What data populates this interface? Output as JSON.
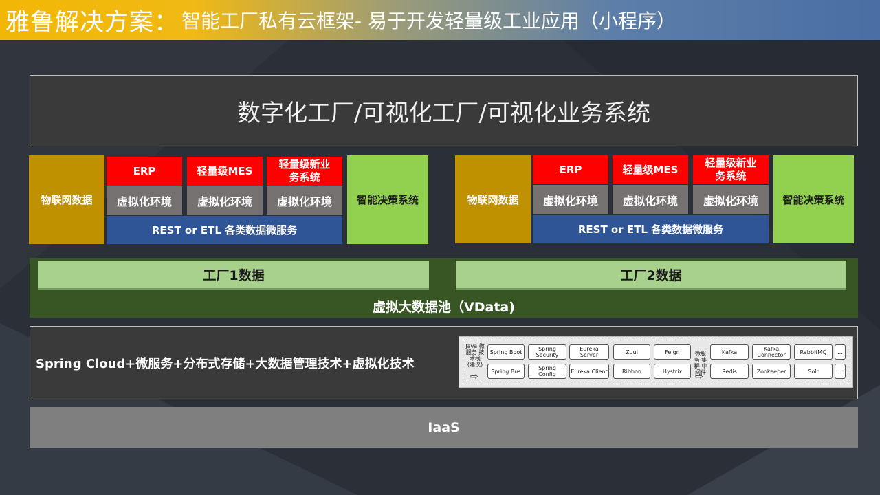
{
  "header": {
    "brand": "雅鲁解决方案：",
    "subtitle": "智能工厂私有云框架- 易于开发轻量级工业应用（小程序）"
  },
  "top_layer": "数字化工厂/可视化工厂/可视化业务系统",
  "factories": [
    {
      "iot": "物联网数据",
      "apps": [
        {
          "name": "ERP",
          "env": "虚拟化环境"
        },
        {
          "name": "轻量级MES",
          "env": "虚拟化环境"
        },
        {
          "name": "轻量级新业务系统",
          "env": "虚拟化环境"
        }
      ],
      "rest": "REST or ETL 各类数据微服务",
      "decision": "智能决策系统",
      "data_label": "工厂1数据"
    },
    {
      "iot": "物联网数据",
      "apps": [
        {
          "name": "ERP",
          "env": "虚拟化环境"
        },
        {
          "name": "轻量级MES",
          "env": "虚拟化环境"
        },
        {
          "name": "轻量级新业务系统",
          "env": "虚拟化环境"
        }
      ],
      "rest": "REST or ETL 各类数据微服务",
      "decision": "智能决策系统",
      "data_label": "工厂2数据"
    }
  ],
  "pool_label": "虚拟大数据池（VData)",
  "infra_text": "Spring Cloud+微服务+分布式存储+大数据管理技术+虚拟化技术",
  "tech_panel": {
    "left_label": "Java 微服务 技术栈 (建议)",
    "mid_label": "微服务 集群 中间件",
    "arrow": "⇨",
    "row1": [
      "Spring Boot",
      "Spring Security",
      "Eureka Server",
      "Zuul",
      "Feign"
    ],
    "row2": [
      "Spring Bus",
      "Spring Config",
      "Eureka Client",
      "Ribbon",
      "Hystrix"
    ],
    "row1_right": [
      "Kafka",
      "Kafka Connector",
      "RabbitMQ",
      "..."
    ],
    "row2_right": [
      "Redis",
      "Zookeeper",
      "Solr",
      "..."
    ]
  },
  "iaas": "IaaS",
  "colors": {
    "background": "#2b3038",
    "iot": "#bf9000",
    "app_header": "#ff0000",
    "virtual_env": "#767171",
    "rest": "#2f5597",
    "decision": "#92d050",
    "pool": "#375623",
    "factory_data": "#a9d18e",
    "iaas": "#7f7f7f"
  }
}
